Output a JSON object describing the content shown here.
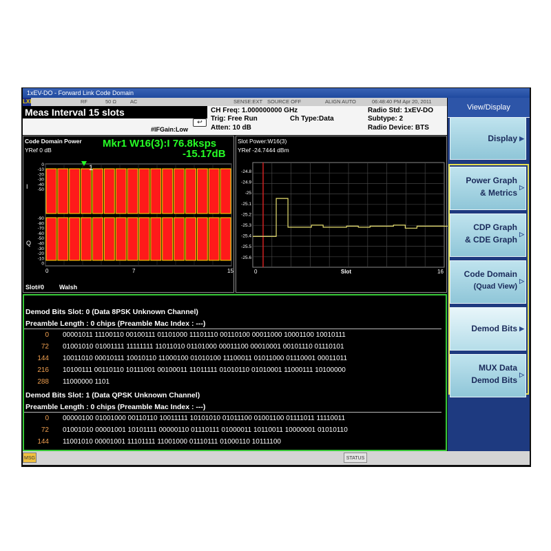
{
  "window": {
    "title": "1xEV-DO - Forward Link Code Domain"
  },
  "status_bar": {
    "logo": "LXI",
    "rf": "RF",
    "impedance": "50 Ω",
    "coupling": "AC",
    "sense": "SENSE:EXT",
    "source": "SOURCE OFF",
    "align": "ALIGN AUTO",
    "datetime": "06:48:40 PM Apr 20, 2011"
  },
  "info": {
    "meas_interval": "Meas Interval  15 slots",
    "ch_freq": "CH Freq: 1.000000000 GHz",
    "trig": "Trig: Free Run",
    "ch_type": "Ch Type:Data",
    "atten": "Atten: 10 dB",
    "ifgain": "#IFGain:Low",
    "radio_std": "Radio Std: 1xEV-DO",
    "subtype": "Subtype: 2",
    "radio_device": "Radio Device: BTS"
  },
  "code_domain_panel": {
    "title": "Code Domain Power",
    "yref": "YRef  0 dB",
    "marker_line1": "Mkr1 W16(3):I 76.8ksps",
    "marker_line2": "-15.17dB",
    "marker_label": "1",
    "i_label": "I",
    "q_label": "Q",
    "y_ticks_i": [
      "0",
      "-10",
      "-20",
      "-30",
      "-40",
      "-50"
    ],
    "y_ticks_q": [
      "-90",
      "-80",
      "-70",
      "-60",
      "-50",
      "-40",
      "-30",
      "-20",
      "-10",
      "0"
    ],
    "x_ticks": [
      "0",
      "7",
      "15"
    ],
    "footer_left": "Slot#0",
    "footer_right": "Walsh"
  },
  "slot_power_panel": {
    "title": "Slot Power:W16(3)",
    "yref": "YRef   -24.7444 dBm",
    "y_ticks": [
      "-24.8",
      "-24.9",
      "-25",
      "-25.1",
      "-25.2",
      "-25.3",
      "-25.4",
      "-25.5",
      "-25.6"
    ],
    "x_ticks": [
      "0",
      "Slot",
      "16"
    ]
  },
  "demod": {
    "slot0": {
      "header": "Demod Bits  Slot:  0  (Data   8PSK     Unknown Channel)",
      "preamble": "Preamble Length : 0 chips       (Preamble Mac Index : ---)",
      "rows": [
        {
          "index": "0",
          "bits": "00001011 11100110 00100111 01101000 11101110 00110100 00011000 10001100 10010111"
        },
        {
          "index": "72",
          "bits": "01001010 01001111 11111111 11011010 01101000 00011100 00010001 00101110 01110101"
        },
        {
          "index": "144",
          "bits": "10011010 00010111 10010110 11000100 01010100 11100011 01011000 01110001 00011011"
        },
        {
          "index": "216",
          "bits": "10100111 00110110 10111001 00100011 11011111 01010110 01010001 11000111 10100000"
        },
        {
          "index": "288",
          "bits": "11000000 1101"
        }
      ]
    },
    "slot1": {
      "header": "Demod Bits  Slot:  1  (Data   QPSK     Unknown Channel)",
      "preamble": "Preamble Length : 0 chips       (Preamble Mac Index : ---)",
      "rows": [
        {
          "index": "0",
          "bits": "00000100 01001000 00110110 10011111 10101010 01011100 01001100 01111011 11110011"
        },
        {
          "index": "72",
          "bits": "01001010 00001001 10101111 00000110 01110111 01000011 10110011 10000001 01010110"
        },
        {
          "index": "144",
          "bits": "11001010 00001001 11101111 11001000 01110111 01000110 10111100"
        }
      ]
    }
  },
  "softkeys": {
    "menu_title": "View/Display",
    "display": "Display",
    "power_graph_1": "Power Graph",
    "power_graph_2": "& Metrics",
    "cdp_graph_1": "CDP Graph",
    "cdp_graph_2": "& CDE Graph",
    "code_domain_1": "Code Domain",
    "code_domain_2": "(Quad View)",
    "demod_bits": "Demod Bits",
    "mux_1": "MUX Data",
    "mux_2": "Demod Bits"
  },
  "bottom_bar": {
    "msg": "MSG",
    "status": "STATUS"
  },
  "colors": {
    "bar_fill": "#ff1a1a",
    "bar_edge": "#ffe000",
    "marker": "#26ff26",
    "trace": "#e8e070",
    "index_num": "#f0a050"
  }
}
